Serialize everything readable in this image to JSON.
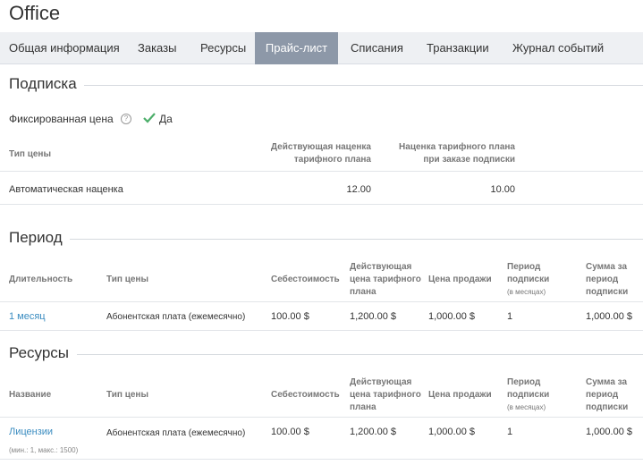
{
  "app": {
    "title": "Office"
  },
  "tabs": [
    {
      "label": "Общая информация"
    },
    {
      "label": "Заказы"
    },
    {
      "label": "Ресурсы"
    },
    {
      "label": "Прайс-лист"
    },
    {
      "label": "Списания"
    },
    {
      "label": "Транзакции"
    },
    {
      "label": "Журнал событий"
    }
  ],
  "subscription": {
    "title": "Подписка",
    "fixed_price_label": "Фиксированная цена",
    "fixed_price_value": "Да",
    "headers": {
      "price_type": "Тип цены",
      "current_markup_1": "Действующая наценка",
      "current_markup_2": "тарифного плана",
      "plan_markup_1": "Наценка тарифного плана",
      "plan_markup_2": "при заказе подписки"
    },
    "row": {
      "price_type": "Автоматическая наценка",
      "current_markup": "12.00",
      "plan_markup": "10.00"
    }
  },
  "period": {
    "title": "Период",
    "headers": {
      "duration": "Длительность",
      "price_type": "Тип цены",
      "cost": "Себестоимость",
      "plan_price_1": "Действующая",
      "plan_price_2": "цена тарифного",
      "plan_price_3": "плана",
      "sale_price": "Цена продажи",
      "sub_period_1": "Период",
      "sub_period_2": "подписки",
      "sub_period_3": "(в месяцах)",
      "sum_1": "Сумма за",
      "sum_2": "период",
      "sum_3": "подписки"
    },
    "row": {
      "duration": "1 месяц",
      "price_type": "Абонентская плата (ежемесячно)",
      "cost": "100.00 $",
      "plan_price": "1,200.00 $",
      "sale_price": "1,000.00 $",
      "sub_period": "1",
      "sum": "1,000.00 $"
    }
  },
  "resources": {
    "title": "Ресурсы",
    "headers": {
      "name": "Название",
      "price_type": "Тип цены",
      "cost": "Себестоимость",
      "plan_price_1": "Действующая",
      "plan_price_2": "цена тарифного",
      "plan_price_3": "плана",
      "sale_price": "Цена продажи",
      "sub_period_1": "Период",
      "sub_period_2": "подписки",
      "sub_period_3": "(в месяцах)",
      "sum_1": "Сумма за",
      "sum_2": "период",
      "sum_3": "подписки"
    },
    "row": {
      "name": "Лицензии",
      "limits": "(мин.: 1, макс.: 1500)",
      "price_type": "Абонентская плата (ежемесячно)",
      "cost": "100.00 $",
      "plan_price": "1,200.00 $",
      "sale_price": "1,000.00 $",
      "sub_period": "1",
      "sum": "1,000.00 $"
    }
  },
  "colors": {
    "active_tab_bg": "#8d98a8",
    "link": "#3a8cc0",
    "check": "#4cae6a"
  }
}
